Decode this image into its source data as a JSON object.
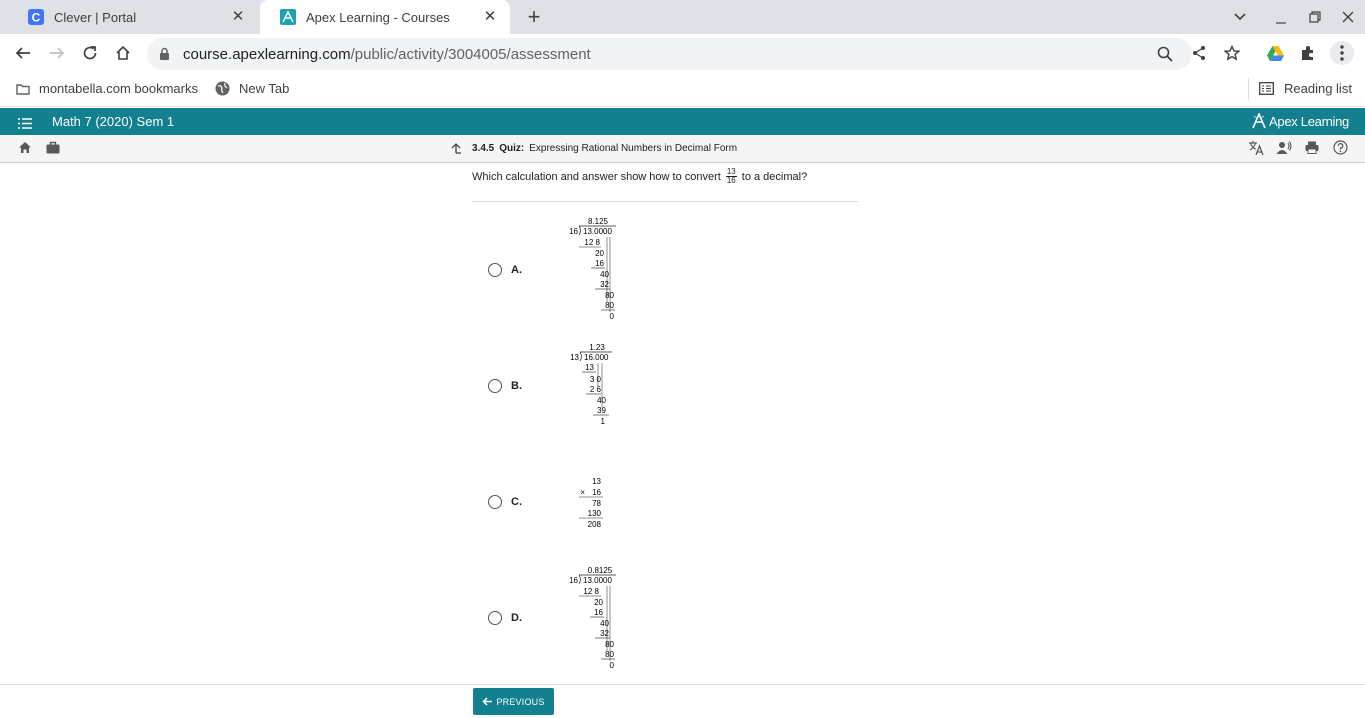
{
  "browser": {
    "tabs": [
      {
        "title": "Clever | Portal",
        "favicon": "clever-icon",
        "active": false
      },
      {
        "title": "Apex Learning - Courses",
        "favicon": "apex-icon",
        "active": true
      }
    ],
    "url_host": "course.apexlearning.com",
    "url_path": "/public/activity/3004005/assessment",
    "bookmarks": [
      {
        "label": "montabella.com bookmarks",
        "icon": "folder-icon"
      },
      {
        "label": "New Tab",
        "icon": "globe-icon"
      }
    ],
    "reading_list": "Reading list"
  },
  "apex": {
    "course_title": "Math 7 (2020) Sem 1",
    "logo_text": "Apex Learning",
    "crumb_number": "3.4.5",
    "crumb_type": "Quiz:",
    "crumb_title": "Expressing Rational Numbers in Decimal Form",
    "brand_color": "#12808f"
  },
  "question": {
    "text_before": "Which calculation and answer show how to convert",
    "fraction_num": "13",
    "fraction_den": "16",
    "text_after": "to a decimal?"
  },
  "options": [
    {
      "label": "A.",
      "quotient": "8.125",
      "divisor": "16",
      "dividend": "13.0000",
      "steps": [
        "12 8",
        "20",
        "16",
        "40",
        "32",
        "80",
        "80",
        "0"
      ]
    },
    {
      "label": "B.",
      "quotient": "1.23",
      "divisor": "13",
      "dividend": "16.000",
      "steps": [
        "13",
        "3 0",
        "2 6",
        "40",
        "39",
        "1"
      ]
    },
    {
      "label": "C.",
      "rows": [
        "13",
        "16",
        "78",
        "130",
        "208"
      ],
      "operator": "×"
    },
    {
      "label": "D.",
      "quotient": "0.8125",
      "divisor": "16",
      "dividend": "13.0000",
      "steps": [
        "12 8",
        "20",
        "16",
        "40",
        "32",
        "80",
        "80",
        "0"
      ]
    }
  ],
  "footer": {
    "previous_label": "PREVIOUS"
  }
}
